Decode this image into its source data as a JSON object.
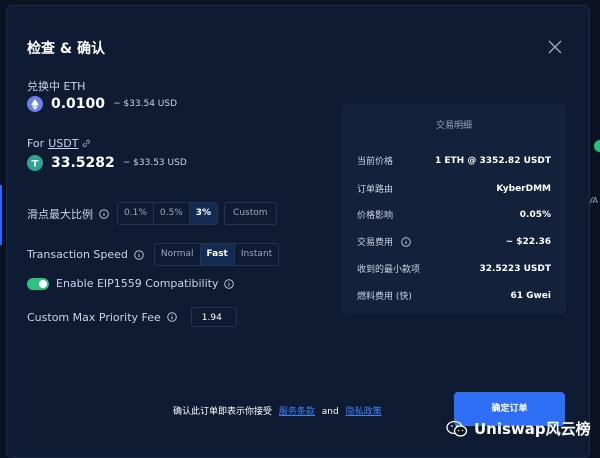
{
  "modal": {
    "title": "检查 & 确认"
  },
  "swap": {
    "from_label": "兑换中 ETH",
    "from_amount": "0.0100",
    "from_usd": "~ $33.54 USD",
    "to_prefix": "For",
    "to_token": "USDT",
    "to_amount": "33.5282",
    "to_usd": "~ $33.53 USD"
  },
  "slippage": {
    "label": "滑点最大比例",
    "options": [
      "0.1%",
      "0.5%",
      "3%"
    ],
    "selected": "3%",
    "custom_label": "Custom"
  },
  "speed": {
    "label": "Transaction Speed",
    "options": [
      "Normal",
      "Fast",
      "Instant"
    ],
    "selected": "Fast"
  },
  "eip1559": {
    "label": "Enable EIP1559 Compatibility",
    "enabled": true
  },
  "priority_fee": {
    "label": "Custom Max Priority Fee",
    "value": "1.94"
  },
  "details": {
    "title": "交易明细",
    "rows": [
      {
        "key": "当前价格",
        "value": "1 ETH @ 3352.82 USDT"
      },
      {
        "key": "订单路由",
        "value": "KyberDMM"
      },
      {
        "key": "价格影响",
        "value": "0.05%"
      },
      {
        "key": "交易费用",
        "value": "~ $22.36"
      },
      {
        "key": "收到的最小款项",
        "value": "32.5223 USDT"
      },
      {
        "key": "燃料费用 (快)",
        "value": "61 Gwei"
      }
    ]
  },
  "footer": {
    "text": "确认此订单即表示你接受",
    "terms": "服务条款",
    "and": "and",
    "privacy": "隐私政策"
  },
  "confirm_button": "确定订单",
  "watermark": "Uniswap风云榜",
  "page_right_edge": "VA",
  "colors": {
    "background": "#0b1221",
    "modal": "#0f1b33",
    "accent": "#2f6ff6",
    "toggle_on": "#2ec27e",
    "link": "#3b82f6"
  },
  "icons": [
    "close-icon",
    "eth-icon",
    "usdt-icon",
    "link-icon",
    "info-icon",
    "wechat-icon"
  ]
}
